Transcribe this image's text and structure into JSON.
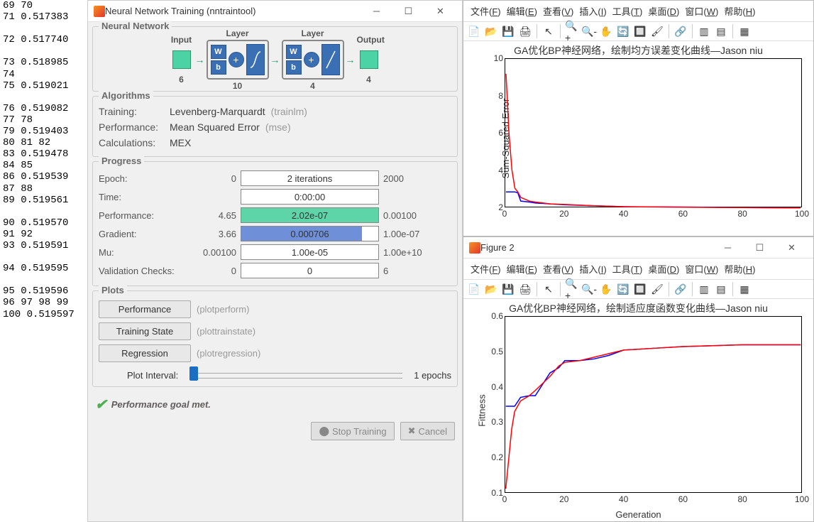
{
  "left_numbers": "69 70\n71 0.517383\n\n72 0.517740\n\n73 0.518985\n74\n75 0.519021\n\n76 0.519082\n77 78\n79 0.519403\n80 81 82\n83 0.519478\n84 85\n86 0.519539\n87 88\n89 0.519561\n\n90 0.519570\n91 92\n93 0.519591\n\n94 0.519595\n\n95 0.519596\n96 97 98 99\n100 0.519597",
  "nntool": {
    "title": "Neural Network Training (nntraintool)",
    "section_nn": "Neural Network",
    "diagram": {
      "input_label": "Input",
      "input_n": "6",
      "layer_label": "Layer",
      "hidden_n": "10",
      "out_n": "4",
      "output_label": "Output"
    },
    "section_algo": "Algorithms",
    "algo": {
      "training_lbl": "Training:",
      "training_val": "Levenberg-Marquardt",
      "training_fn": "(trainlm)",
      "perf_lbl": "Performance:",
      "perf_val": "Mean Squared Error",
      "perf_fn": "(mse)",
      "calc_lbl": "Calculations:",
      "calc_val": "MEX"
    },
    "section_prog": "Progress",
    "progress": {
      "epoch_lbl": "Epoch:",
      "epoch_start": "0",
      "epoch_bar": "2 iterations",
      "epoch_end": "2000",
      "time_lbl": "Time:",
      "time_bar": "0:00:00",
      "perf_lbl": "Performance:",
      "perf_start": "4.65",
      "perf_bar": "2.02e-07",
      "perf_end": "0.00100",
      "grad_lbl": "Gradient:",
      "grad_start": "3.66",
      "grad_bar": "0.000706",
      "grad_end": "1.00e-07",
      "mu_lbl": "Mu:",
      "mu_start": "0.00100",
      "mu_bar": "1.00e-05",
      "mu_end": "1.00e+10",
      "val_lbl": "Validation Checks:",
      "val_start": "0",
      "val_bar": "0",
      "val_end": "6"
    },
    "section_plots": "Plots",
    "plots": {
      "perf_btn": "Performance",
      "perf_fn": "(plotperform)",
      "train_btn": "Training State",
      "train_fn": "(plottrainstate)",
      "reg_btn": "Regression",
      "reg_fn": "(plotregression)",
      "interval_lbl": "Plot Interval:",
      "interval_val": "1 epochs"
    },
    "status": "Performance goal met.",
    "stop_btn": "Stop Training",
    "cancel_btn": "Cancel"
  },
  "menus": {
    "file": "文件(F)",
    "edit": "编辑(E)",
    "view": "查看(V)",
    "insert": "插入(I)",
    "tools": "工具(T)",
    "desktop": "桌面(D)",
    "window": "窗口(W)",
    "help": "帮助(H)"
  },
  "fig1": {
    "title": "GA优化BP神经网络，绘制均方误差变化曲线—Jason niu",
    "ylabel": "Sum-Squared Error",
    "xticks": [
      "0",
      "20",
      "40",
      "60",
      "80",
      "100"
    ],
    "yticks": [
      "2",
      "4",
      "6",
      "8",
      "10"
    ]
  },
  "fig2": {
    "wintitle": "Figure 2",
    "title": "GA优化BP神经网络，绘制适应度函数变化曲线—Jason niu",
    "ylabel": "Fittness",
    "xlabel": "Generation",
    "xticks": [
      "0",
      "20",
      "40",
      "60",
      "80",
      "100"
    ],
    "yticks": [
      "0.1",
      "0.2",
      "0.3",
      "0.4",
      "0.5",
      "0.6"
    ]
  },
  "chart_data": [
    {
      "type": "line",
      "title": "GA优化BP神经网络，绘制均方误差变化曲线—Jason niu",
      "xlabel": "",
      "ylabel": "Sum-Squared Error",
      "xlim": [
        0,
        100
      ],
      "ylim": [
        2,
        10
      ],
      "series": [
        {
          "name": "blue",
          "color": "#0000ff",
          "x": [
            0,
            1,
            2,
            3,
            4,
            5,
            8,
            10,
            15,
            20,
            30,
            40,
            60,
            80,
            100
          ],
          "y": [
            2.8,
            2.8,
            2.8,
            2.8,
            2.75,
            2.3,
            2.25,
            2.2,
            2.15,
            2.1,
            2.05,
            2.0,
            1.98,
            1.95,
            1.93
          ]
        },
        {
          "name": "red",
          "color": "#ff0000",
          "x": [
            0,
            1,
            2,
            3,
            4,
            5,
            8,
            10,
            15,
            20,
            30,
            40,
            60,
            80,
            100
          ],
          "y": [
            9.2,
            6.0,
            4.0,
            3.0,
            2.8,
            2.5,
            2.3,
            2.25,
            2.15,
            2.12,
            2.05,
            2.0,
            1.97,
            1.95,
            1.93
          ]
        }
      ]
    },
    {
      "type": "line",
      "title": "GA优化BP神经网络，绘制适应度函数变化曲线—Jason niu",
      "xlabel": "Generation",
      "ylabel": "Fittness",
      "xlim": [
        0,
        100
      ],
      "ylim": [
        0.1,
        0.6
      ],
      "series": [
        {
          "name": "blue",
          "color": "#0000ff",
          "x": [
            0,
            3,
            5,
            8,
            10,
            15,
            18,
            20,
            25,
            30,
            35,
            40,
            50,
            60,
            80,
            100
          ],
          "y": [
            0.345,
            0.345,
            0.37,
            0.375,
            0.375,
            0.44,
            0.455,
            0.475,
            0.475,
            0.48,
            0.49,
            0.505,
            0.51,
            0.515,
            0.52,
            0.52
          ]
        },
        {
          "name": "red",
          "color": "#ff0000",
          "x": [
            0,
            2,
            3,
            5,
            8,
            10,
            15,
            18,
            20,
            25,
            30,
            35,
            40,
            50,
            60,
            80,
            100
          ],
          "y": [
            0.11,
            0.28,
            0.33,
            0.36,
            0.375,
            0.39,
            0.43,
            0.46,
            0.47,
            0.475,
            0.485,
            0.495,
            0.505,
            0.51,
            0.515,
            0.52,
            0.52
          ]
        }
      ]
    }
  ]
}
